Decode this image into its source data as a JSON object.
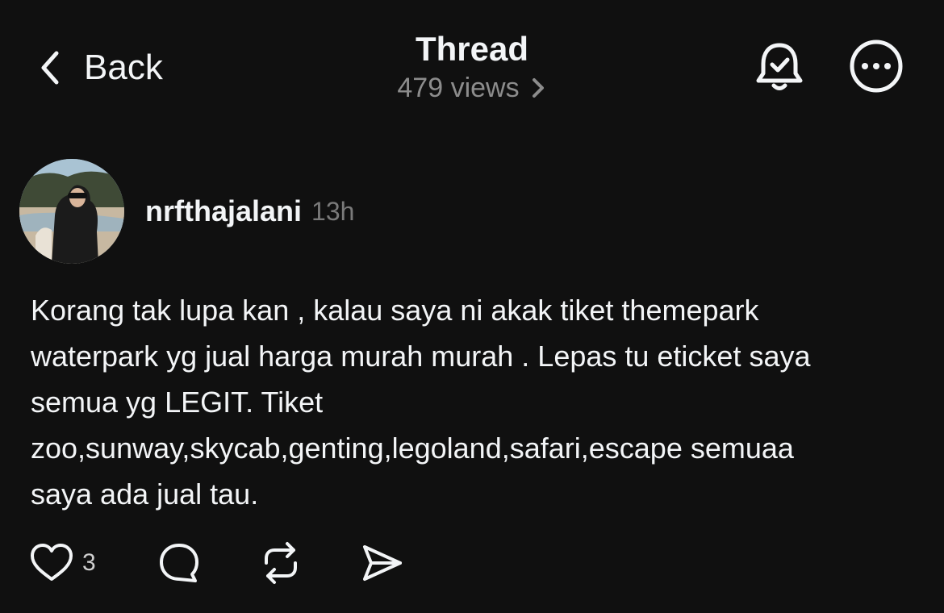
{
  "header": {
    "back_label": "Back",
    "title": "Thread",
    "views": "479 views"
  },
  "icons": {
    "back": "chevron-left-icon",
    "views_arrow": "chevron-right-icon",
    "bell": "bell-check-icon",
    "more": "more-circle-icon",
    "like": "heart-icon",
    "reply": "comment-icon",
    "repost": "repost-icon",
    "share": "send-icon"
  },
  "post": {
    "author": "nrfthajalani",
    "time": "13h",
    "text": "Korang tak lupa kan , kalau saya ni akak tiket themepark\nwaterpark yg jual harga murah murah . Lepas tu eticket saya\nsemua yg LEGIT. Tiket\nzoo,sunway,skycab,genting,legoland,safari,escape semuaa\nsaya ada jual tau.",
    "like_count": "3"
  },
  "colors": {
    "background": "#101010",
    "text": "#f3f5f7",
    "secondary": "#8c8c8c"
  }
}
